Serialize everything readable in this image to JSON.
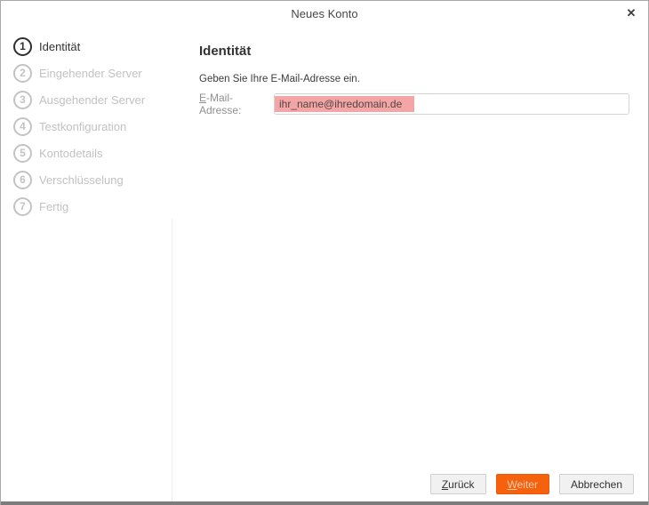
{
  "dialog": {
    "title": "Neues Konto",
    "close_glyph": "✕"
  },
  "sidebar": {
    "steps": [
      {
        "number": "1",
        "label": "Identität",
        "active": true
      },
      {
        "number": "2",
        "label": "Eingehender Server",
        "active": false
      },
      {
        "number": "3",
        "label": "Ausgehender Server",
        "active": false
      },
      {
        "number": "4",
        "label": "Testkonfiguration",
        "active": false
      },
      {
        "number": "5",
        "label": "Kontodetails",
        "active": false
      },
      {
        "number": "6",
        "label": "Verschlüsselung",
        "active": false
      },
      {
        "number": "7",
        "label": "Fertig",
        "active": false
      }
    ]
  },
  "main": {
    "heading": "Identität",
    "instruction": "Geben Sie Ihre E-Mail-Adresse ein.",
    "email_field": {
      "label_accesskey": "E",
      "label_rest": "-Mail-Adresse:",
      "value": "ihr_name@ihredomain.de"
    }
  },
  "footer": {
    "back_accesskey": "Z",
    "back_rest": "urück",
    "next_accesskey": "W",
    "next_rest": "eiter",
    "cancel_label": "Abbrechen"
  },
  "colors": {
    "accent_orange": "#f5610d",
    "selection_pink": "#f4a6a6",
    "inactive_step_gray": "#c3c3c3"
  }
}
